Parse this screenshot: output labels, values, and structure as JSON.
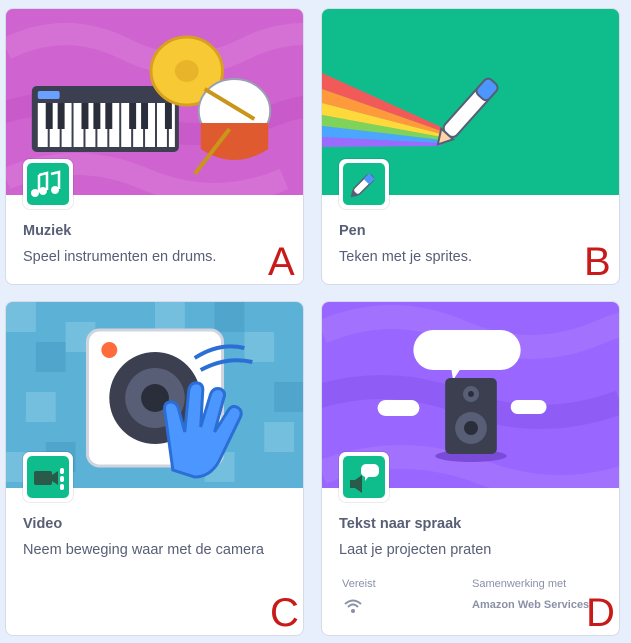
{
  "cards": [
    {
      "title": "Muziek",
      "description": "Speel instrumenten en drums.",
      "marker": "A"
    },
    {
      "title": "Pen",
      "description": "Teken met je sprites.",
      "marker": "B"
    },
    {
      "title": "Video",
      "description": "Neem beweging waar met de camera",
      "marker": "C"
    },
    {
      "title": "Tekst naar spraak",
      "description": "Laat je projecten praten",
      "marker": "D",
      "requires_label": "Vereist",
      "partner_label": "Samenwerking met",
      "partner_value": "Amazon Web Services"
    }
  ],
  "colors": {
    "background": "#e8effc",
    "muziek_banner": "#cf63cf",
    "pen_banner": "#0fbd8c",
    "video_banner": "#5cb1d6",
    "speech_banner": "#9966ff",
    "icon_tile": "#0fbd8c",
    "marker": "#c91a1a",
    "text": "#575e75"
  },
  "icons": [
    "music-notes-icon",
    "pen-icon",
    "video-sensing-icon",
    "speech-icon",
    "wifi-icon"
  ]
}
